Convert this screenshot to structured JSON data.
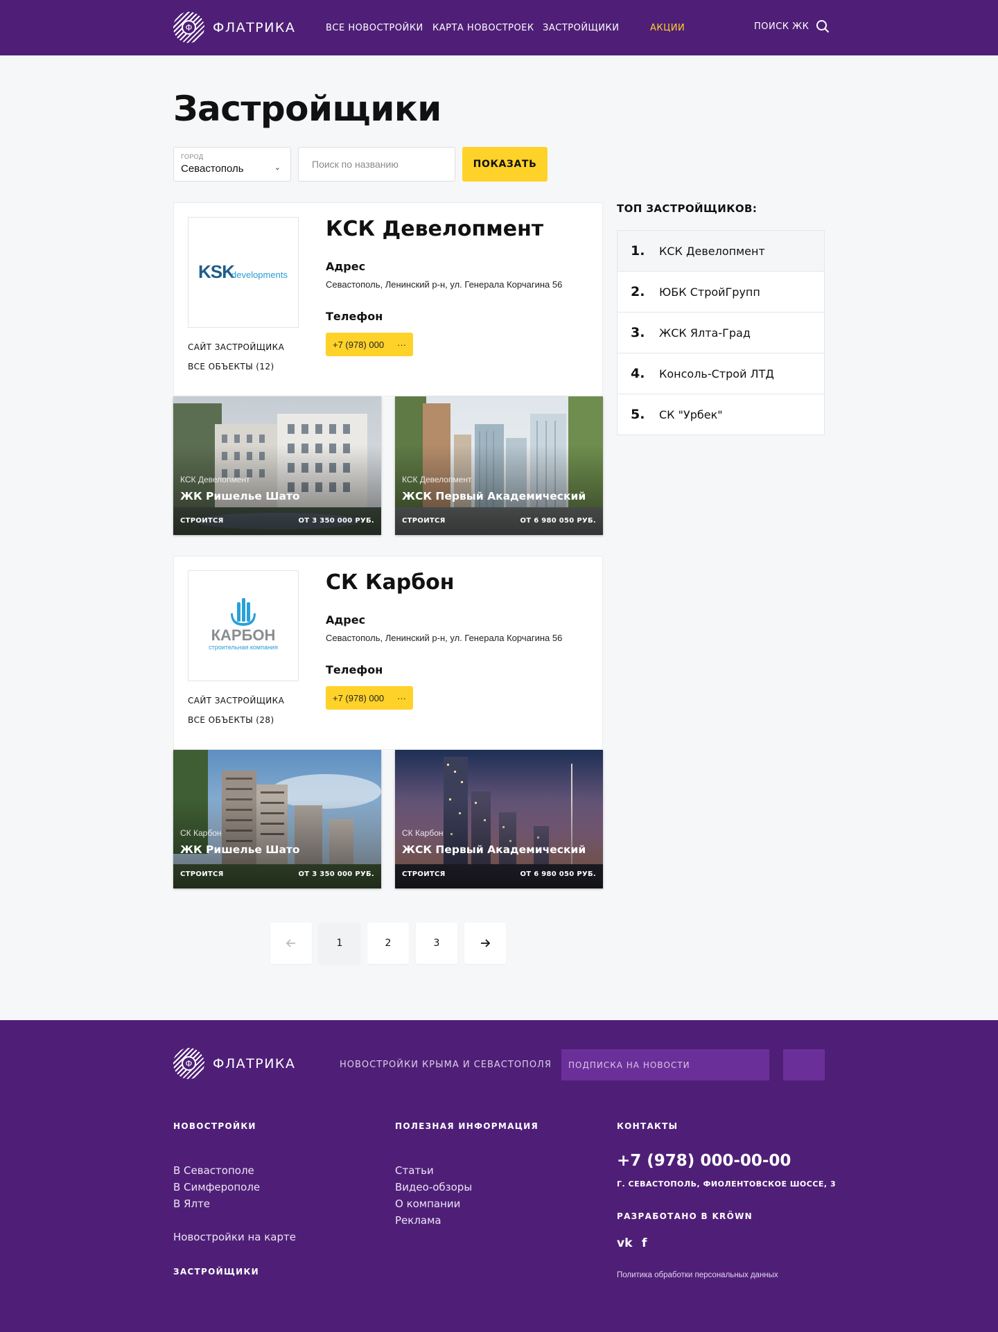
{
  "header": {
    "brand": "ФЛАТРИКА",
    "logo_letter": "Ф",
    "nav": [
      "ВСЕ НОВОСТРОЙКИ",
      "КАРТА НОВОСТРОЕК",
      "ЗАСТРОЙЩИКИ",
      "АКЦИИ"
    ],
    "search_label": "ПОИСК ЖК",
    "accent_color": "#ffd22a",
    "bg_color": "#4f1f77"
  },
  "page": {
    "title": "Застройщики"
  },
  "filters": {
    "city_label": "ГОРОД",
    "city_value": "Севастополь",
    "search_placeholder": "Поиск по названию",
    "show_button": "ПОКАЗАТЬ"
  },
  "developers": [
    {
      "name": "КСК Девелопмент",
      "logo": {
        "main": "KSK",
        "sub": "developments"
      },
      "site_link": "САЙТ ЗАСТРОЙЩИКА",
      "objects_link": "ВСЕ ОБЪЕКТЫ (12)",
      "address_label": "Адрес",
      "address": "Севастополь, Ленинский р-н, ул. Генерала Корчагина 56",
      "phone_label": "Телефон",
      "phone": "+7 (978) 000",
      "phone_more": "···",
      "properties": [
        {
          "developer": "КСК Девелопмент",
          "name": "ЖК Ришелье Шато",
          "status": "СТРОИТСЯ",
          "price": "ОТ 3 350 000 РУБ."
        },
        {
          "developer": "КСК Девелопмент",
          "name": "ЖСК Первый Академический",
          "status": "СТРОИТСЯ",
          "price": "ОТ 6 980 050 РУБ."
        }
      ]
    },
    {
      "name": "СК Карбон",
      "logo": {
        "main": "КАРБОН",
        "sub": "строительная компания"
      },
      "site_link": "САЙТ ЗАСТРОЙЩИКА",
      "objects_link": "ВСЕ ОБЪЕКТЫ (28)",
      "address_label": "Адрес",
      "address": "Севастополь, Ленинский р-н, ул. Генерала Корчагина 56",
      "phone_label": "Телефон",
      "phone": "+7 (978) 000",
      "phone_more": "···",
      "properties": [
        {
          "developer": "СК Карбон",
          "name": "ЖК Ришелье Шато",
          "status": "СТРОИТСЯ",
          "price": "ОТ 3 350 000 РУБ."
        },
        {
          "developer": "СК Карбон",
          "name": "ЖСК Первый Академический",
          "status": "СТРОИТСЯ",
          "price": "ОТ 6 980 050 РУБ."
        }
      ]
    }
  ],
  "top_developers": {
    "title": "ТОП ЗАСТРОЙЩИКОВ:",
    "items": [
      {
        "num": "1.",
        "name": "КСК Девелопмент"
      },
      {
        "num": "2.",
        "name": "ЮБК СтройГрупп"
      },
      {
        "num": "3.",
        "name": "ЖСК Ялта-Град"
      },
      {
        "num": "4.",
        "name": "Консоль-Строй ЛТД"
      },
      {
        "num": "5.",
        "name": "СК \"Урбек\""
      }
    ]
  },
  "pagination": {
    "pages": [
      "1",
      "2",
      "3"
    ],
    "current": "1",
    "prev_icon": "arrow-left-icon",
    "next_icon": "arrow-right-icon"
  },
  "footer": {
    "brand": "ФЛАТРИКА",
    "tagline": "НОВОСТРОЙКИ КРЫМА И СЕВАСТОПОЛЯ",
    "subscribe_placeholder": "ПОДПИСКА НА НОВОСТИ",
    "col1": {
      "title": "НОВОСТРОЙКИ",
      "links": [
        "В Севастополе",
        "В Симферополе",
        "В Ялте"
      ],
      "map_link": "Новостройки на карте",
      "bottom_title": "ЗАСТРОЙЩИКИ"
    },
    "col2": {
      "title": "ПОЛЕЗНАЯ ИНФОРМАЦИЯ",
      "links": [
        "Статьи",
        "Видео-обзоры",
        "О компании",
        "Реклама"
      ]
    },
    "col3": {
      "title": "КОНТАКТЫ",
      "phone": "+7 (978) 000-00-00",
      "address": "Г. СЕВАСТОПОЛЬ, ФИОЛЕНТОВСКОЕ ШОССЕ, 3",
      "developed_by": "РАЗРАБОТАНО В KRÖWN",
      "social": [
        "vk",
        "f"
      ],
      "policy": "Политика обработки персональных данных"
    }
  }
}
